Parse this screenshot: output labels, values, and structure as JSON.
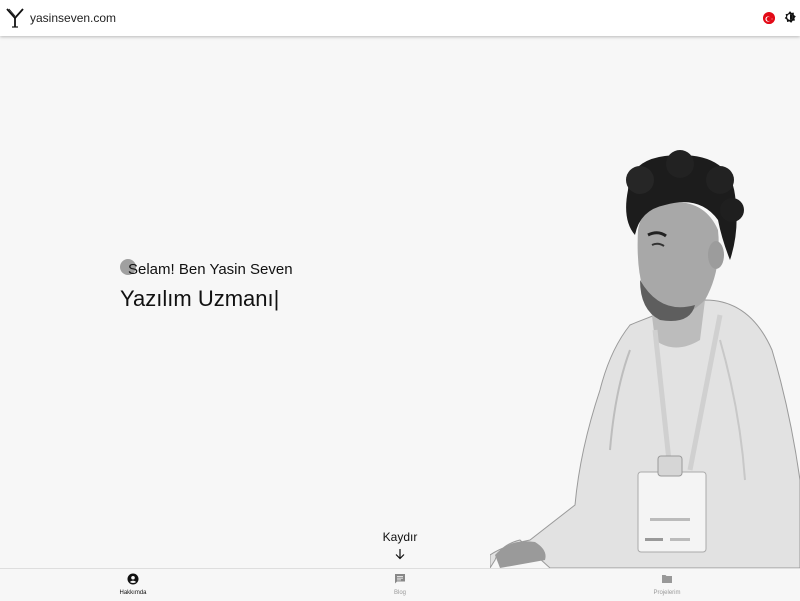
{
  "header": {
    "site_title": "yasinseven.com",
    "logo_icon": "y-logo-icon",
    "language_icon": "turkey-flag-icon",
    "theme_icon": "brightness-icon"
  },
  "hero": {
    "greeting": "Selam! Ben Yasin Seven",
    "role": "Yazılım Uzmanı",
    "caret": "|"
  },
  "scroll": {
    "label": "Kaydır",
    "icon": "arrow-down-icon"
  },
  "bottom_nav": {
    "items": [
      {
        "label": "Hakkımda",
        "icon": "account-circle-icon",
        "active": true
      },
      {
        "label": "Blog",
        "icon": "chat-icon",
        "active": false
      },
      {
        "label": "Projelerim",
        "icon": "folder-icon",
        "active": false
      }
    ]
  },
  "colors": {
    "flag_red": "#e30a17",
    "background": "#f7f7f7",
    "text": "#111111"
  }
}
